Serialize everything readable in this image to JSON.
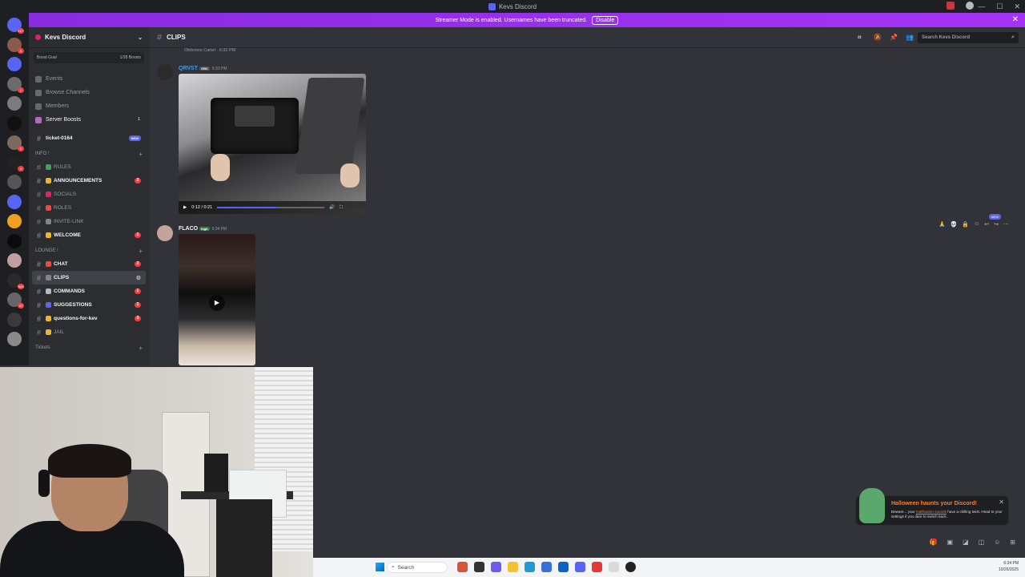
{
  "window": {
    "title": "Kevs Discord"
  },
  "banner": {
    "text": "Streamer Mode is enabled. Usernames have been truncated.",
    "button": "Disable",
    "close": "✕"
  },
  "server_list": {
    "items": [
      {
        "name": "dm-home",
        "color": "#5865f2",
        "badge": "1K+"
      },
      {
        "name": "server-1",
        "color": "#8a5a4a",
        "badge": "6"
      },
      {
        "name": "server-2",
        "color": "#5865f2",
        "badge": ""
      },
      {
        "name": "server-3",
        "color": "#6b6b6b",
        "badge": "1"
      },
      {
        "name": "server-4",
        "color": "#7c7c7c",
        "badge": ""
      },
      {
        "name": "server-5",
        "color": "#111111",
        "badge": ""
      },
      {
        "name": "server-6",
        "color": "#7a6a60",
        "badge": "5"
      },
      {
        "name": "server-7",
        "color": "#222222",
        "badge": "4"
      },
      {
        "name": "server-8",
        "color": "#555555",
        "badge": ""
      },
      {
        "name": "server-9",
        "color": "#5865f2",
        "badge": ""
      },
      {
        "name": "server-10",
        "color": "#f0a020",
        "badge": ""
      },
      {
        "name": "server-11",
        "color": "#0b0b0b",
        "badge": ""
      },
      {
        "name": "server-12",
        "color": "#c0a0a0",
        "badge": ""
      },
      {
        "name": "server-13",
        "color": "#2a2a2a",
        "badge": "SoS"
      },
      {
        "name": "server-14",
        "color": "#666666",
        "badge": "47"
      },
      {
        "name": "server-15",
        "color": "#3a3a3a",
        "badge": ""
      },
      {
        "name": "server-16",
        "color": "#8a8a8a",
        "badge": ""
      }
    ]
  },
  "sidebar": {
    "guild_name": "Kevs Discord",
    "boost_goal": "Boost Goal",
    "boost_count": "1/28 Boosts",
    "nav": [
      {
        "label": "Events",
        "count": ""
      },
      {
        "label": "Browse Channels",
        "count": ""
      },
      {
        "label": "Members",
        "count": ""
      },
      {
        "label": "Server Boosts",
        "count": "1"
      }
    ],
    "ticket": {
      "label": "ticket-0164",
      "pill": "NEW"
    },
    "categories": {
      "info": "INFO !",
      "lounge": "LOUNGE !",
      "tickets": "Tickets"
    },
    "info_channels": [
      {
        "label": "RULES",
        "emoji_color": "#3ba55d",
        "pill": "",
        "unread": false
      },
      {
        "label": "ANNOUNCEMENTS",
        "emoji_color": "#f0b232",
        "pill": "2",
        "unread": true
      },
      {
        "label": "SOCIALS",
        "emoji_color": "#e91e63",
        "pill": "",
        "unread": false
      },
      {
        "label": "ROLES",
        "emoji_color": "#e74c3c",
        "pill": "",
        "unread": false
      },
      {
        "label": "INVITE-LINK",
        "emoji_color": "#80848e",
        "pill": "",
        "unread": false
      },
      {
        "label": "WELCOME",
        "emoji_color": "#f0b232",
        "pill": "1",
        "unread": true
      }
    ],
    "lounge_channels": [
      {
        "label": "CHAT",
        "emoji_color": "#e74c3c",
        "pill": "2",
        "unread": true,
        "active": false
      },
      {
        "label": "CLIPS",
        "emoji_color": "#80848e",
        "pill": "",
        "unread": false,
        "active": true
      },
      {
        "label": "COMMANDS",
        "emoji_color": "#b5bac1",
        "pill": "1",
        "unread": true,
        "active": false
      },
      {
        "label": "SUGGESTIONS",
        "emoji_color": "#5865f2",
        "pill": "1",
        "unread": true,
        "active": false
      },
      {
        "label": "questions-for-kev",
        "emoji_color": "#f0b232",
        "pill": "3",
        "unread": true,
        "active": false
      },
      {
        "label": "JAIL",
        "emoji_color": "#f0b232",
        "pill": "",
        "unread": false,
        "active": false
      }
    ]
  },
  "header": {
    "channel": "CLIPS",
    "search_placeholder": "Search Kevs Discord"
  },
  "messages": {
    "reply_ref": "Oblivions Cartel · 6:32 PM",
    "msg1": {
      "user": "QRVST",
      "user_color": "#3ba0f0",
      "tag": "OBC",
      "time": "6:33 PM",
      "video_time": "0:12 / 0:21",
      "progress": 0.55
    },
    "msg2": {
      "user": "FLACO",
      "user_color": "#f2f3f5",
      "tag": "high",
      "time": "6:34 PM",
      "play": "▶"
    },
    "hover_new": "NEW"
  },
  "notification": {
    "title": "Halloween haunts your Discord!",
    "body_pre": "Beware... your ",
    "body_link": "notification sounds",
    "body_post": " have a chilling twist. Head to your settings if you dare to switch back.",
    "close": "✕"
  },
  "taskbar": {
    "search": "Search",
    "time": "6:34 PM",
    "date": "10/26/2025"
  }
}
